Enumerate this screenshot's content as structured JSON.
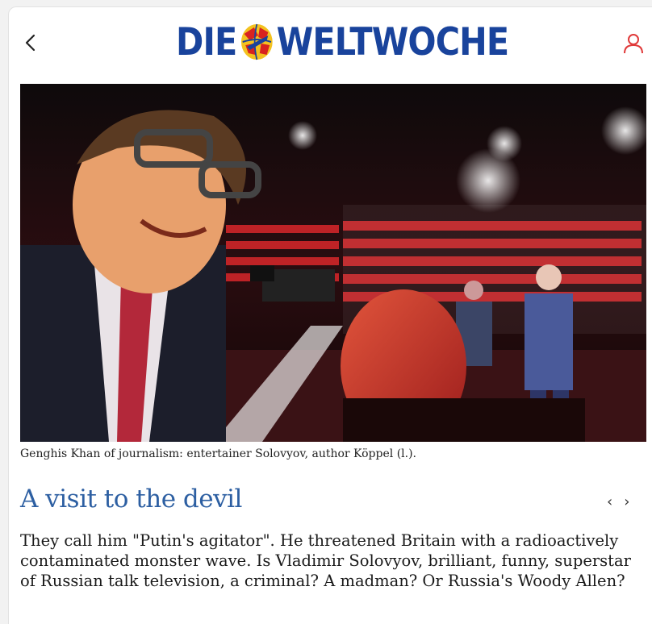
{
  "header": {
    "logo_left": "DIE",
    "logo_right": "WELTWOCHE",
    "back_icon": "chevron-left-icon",
    "user_icon": "user-icon",
    "brand_color": "#19439c",
    "user_icon_color": "#e03a3a"
  },
  "article": {
    "image_alt": "Selfie of two men in a red-lit television studio",
    "caption": "Genghis Khan of journalism: entertainer Solovyov, author Köppel (l.).",
    "title": "A visit to the devil",
    "prev_label": "‹",
    "next_label": "›",
    "lead": "They call him \"Putin's agitator\". He threatened Britain with a radioactively contaminated monster wave. Is Vladimir Solovyov, brilliant, funny, superstar of Russian talk television, a criminal? A madman? Or Russia's Woody Allen?",
    "title_color": "#2d5fa2"
  }
}
